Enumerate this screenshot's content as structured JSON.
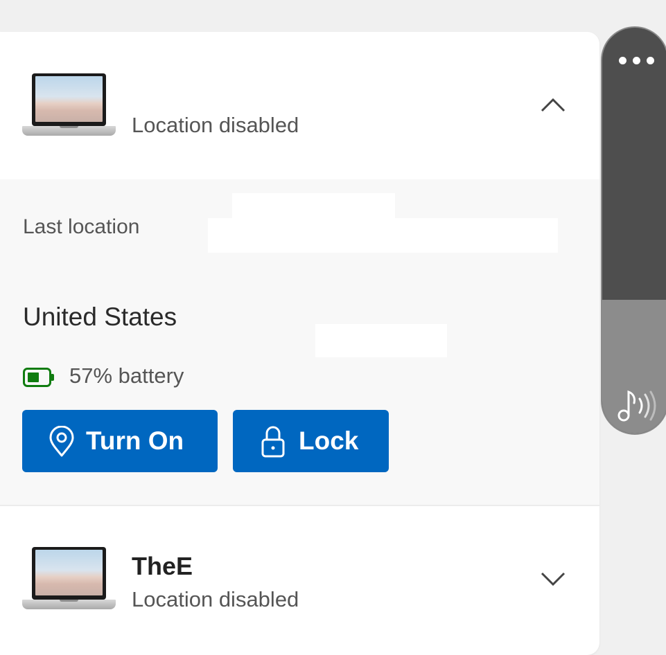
{
  "device1": {
    "status": "Location disabled",
    "expanded": true
  },
  "details": {
    "last_location_label": "Last location",
    "country": "United States",
    "battery_text": "57% battery",
    "battery_level": 0.57,
    "buttons": {
      "turn_on": "Turn On",
      "lock": "Lock"
    }
  },
  "device2": {
    "name": "TheE",
    "status": "Location disabled",
    "expanded": false
  },
  "side_panel": {
    "more_icon": "more-dots-icon",
    "media_icon": "music-note-sound-icon"
  },
  "colors": {
    "accent": "#0067c0",
    "battery": "#107c10",
    "panel_background": "#f8f8f8"
  }
}
